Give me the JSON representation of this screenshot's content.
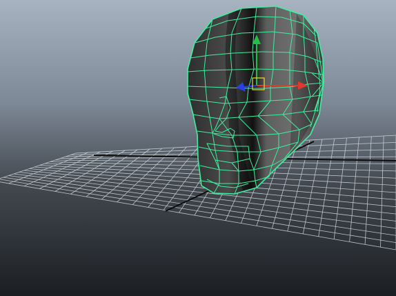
{
  "viewport": {
    "panel": "perspective",
    "mesh": "head-model",
    "selection": "selected",
    "wireframe_color": "#3ef0a0",
    "background_top": "#a7b3c1",
    "background_bottom": "#1b1e22",
    "grid_color": "#d6dde2",
    "grid_axis_color": "#0c0c0c",
    "manipulator": {
      "tool": "move",
      "x_axis_color": "#e03a2e",
      "y_axis_color": "#22c04a",
      "z_axis_color": "#2a40e0",
      "center_color": "#f0e020"
    }
  }
}
